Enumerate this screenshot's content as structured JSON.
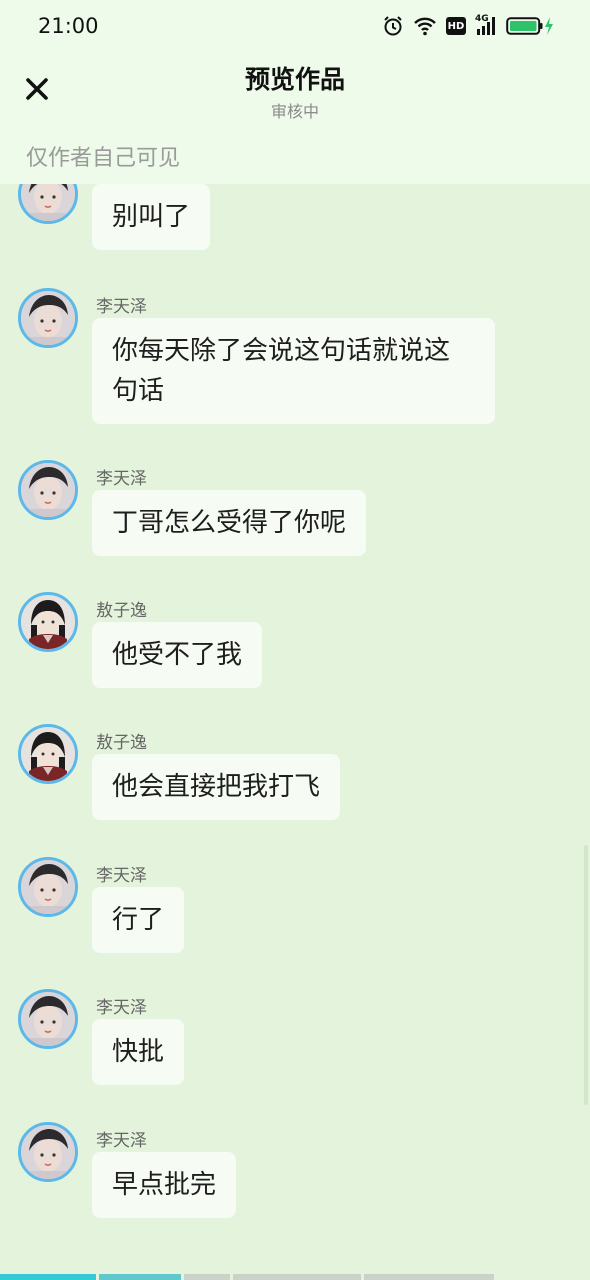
{
  "status_bar": {
    "time": "21:00",
    "network": "4G",
    "hd": "HD"
  },
  "header": {
    "title": "预览作品",
    "subtitle": "审核中",
    "visibility_note": "仅作者自己可见"
  },
  "messages": [
    {
      "sender": "",
      "text": "别叫了",
      "avatar": "avatar-a"
    },
    {
      "sender": "李天泽",
      "text": "你每天除了会说这句话就说这句话",
      "avatar": "avatar-a"
    },
    {
      "sender": "李天泽",
      "text": "丁哥怎么受得了你呢",
      "avatar": "avatar-a"
    },
    {
      "sender": "敖子逸",
      "text": "他受不了我",
      "avatar": "avatar-b"
    },
    {
      "sender": "敖子逸",
      "text": "他会直接把我打飞",
      "avatar": "avatar-b"
    },
    {
      "sender": "李天泽",
      "text": "行了",
      "avatar": "avatar-a"
    },
    {
      "sender": "李天泽",
      "text": "快批",
      "avatar": "avatar-a"
    },
    {
      "sender": "李天泽",
      "text": "早点批完",
      "avatar": "avatar-a"
    }
  ],
  "colors": {
    "background": "#e4f4dc",
    "header_background": "#eefbea",
    "bubble": "#f6fcf3",
    "avatar_ring": "#5cb8ea",
    "progress_active": "#33c9d6",
    "progress_inactive": "#c9d3c8",
    "battery": "#2ec36b"
  }
}
